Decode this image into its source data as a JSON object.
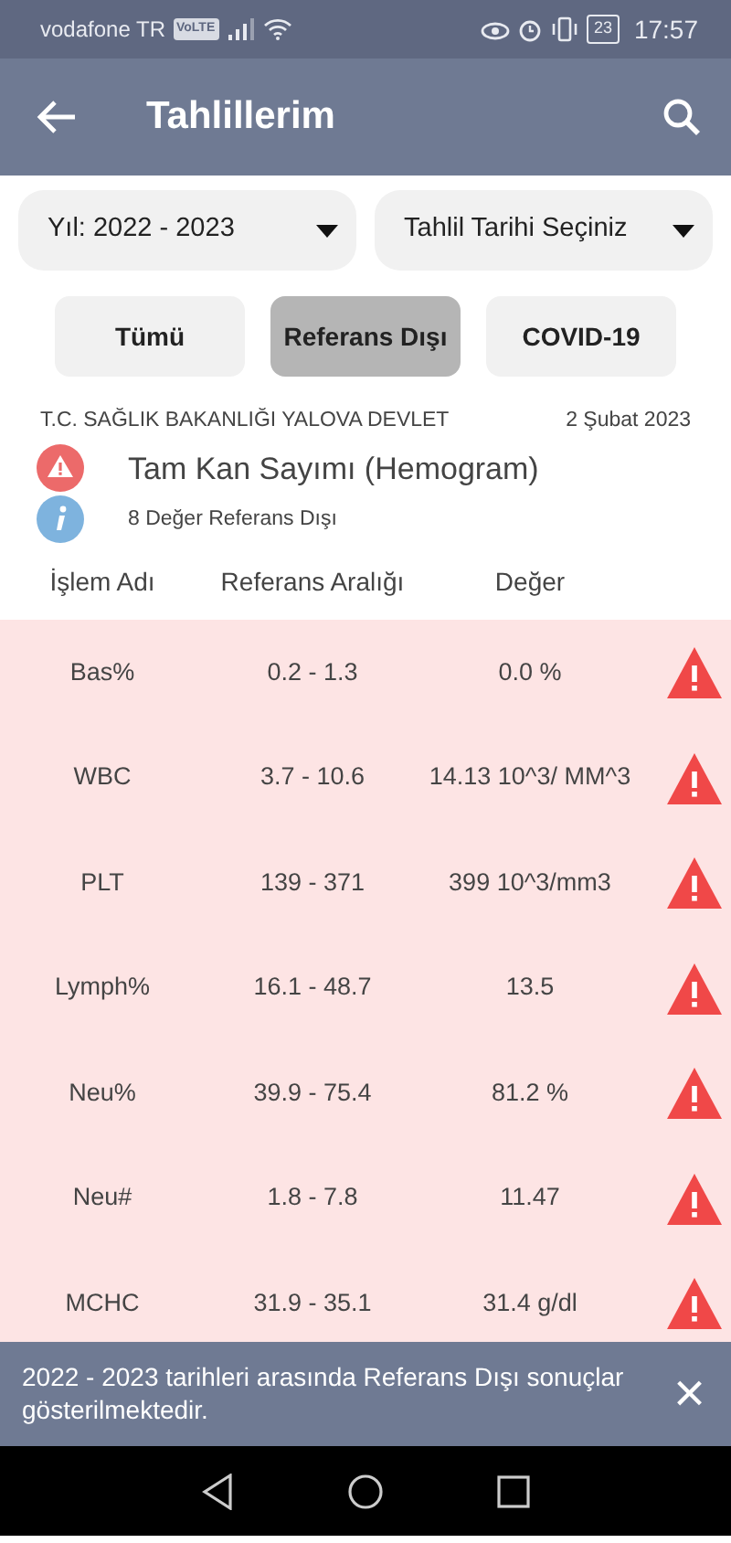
{
  "status_bar": {
    "carrier": "vodafone TR",
    "network_badge": "VoLTE",
    "battery": "23",
    "time": "17:57"
  },
  "app_bar": {
    "title": "Tahlillerim"
  },
  "filters": [
    {
      "label": "Yıl: 2022 - 2023"
    },
    {
      "label": "Tahlil Tarihi Seçiniz"
    }
  ],
  "tabs": [
    {
      "label": "Tümü",
      "selected": false
    },
    {
      "label": "Referans Dışı",
      "selected": true
    },
    {
      "label": "COVID-19",
      "selected": false
    }
  ],
  "result": {
    "institution": "T.C. SAĞLIK BAKANLIĞI YALOVA DEVLET",
    "date": "2 Şubat 2023",
    "test_name": "Tam Kan Sayımı (Hemogram)",
    "summary": "8 Değer Referans Dışı"
  },
  "table": {
    "columns": [
      "İşlem Adı",
      "Referans Aralığı",
      "Değer"
    ],
    "rows": [
      {
        "name": "Bas%",
        "range": "0.2 - 1.3",
        "value": "0.0 %",
        "flagged": true
      },
      {
        "name": "WBC",
        "range": "3.7 - 10.6",
        "value": "14.13 10^3/ MM^3",
        "flagged": true
      },
      {
        "name": "PLT",
        "range": "139 - 371",
        "value": "399 10^3/mm3",
        "flagged": true
      },
      {
        "name": "Lymph%",
        "range": "16.1 - 48.7",
        "value": "13.5",
        "flagged": true
      },
      {
        "name": "Neu%",
        "range": "39.9 - 75.4",
        "value": "81.2 %",
        "flagged": true
      },
      {
        "name": "Neu#",
        "range": "1.8 - 7.8",
        "value": "11.47",
        "flagged": true
      },
      {
        "name": "MCHC",
        "range": "31.9 - 35.1",
        "value": "31.4 g/dl",
        "flagged": true
      }
    ]
  },
  "snackbar": {
    "message": "2022 - 2023 tarihleri arasında Referans Dışı sonuçlar gösterilmektedir.",
    "close": "×"
  }
}
